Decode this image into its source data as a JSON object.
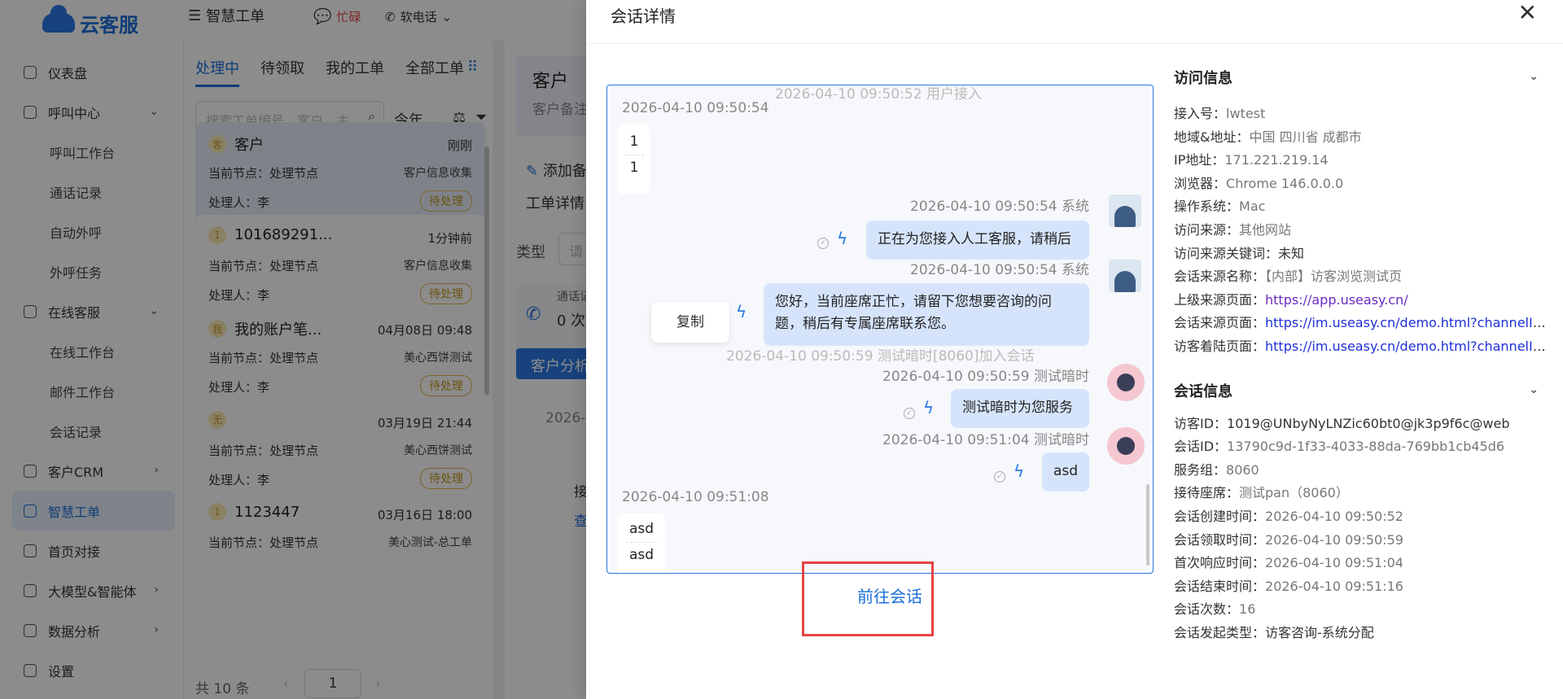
{
  "app": {
    "logo": "云客服"
  },
  "sidebar": {
    "items": [
      {
        "label": "仪表盘",
        "icon": "dashboard-icon",
        "type": "top"
      },
      {
        "label": "呼叫中心",
        "icon": "phone-icon",
        "type": "top",
        "arrow": "⌄"
      },
      {
        "label": "呼叫工作台",
        "type": "sub"
      },
      {
        "label": "通话记录",
        "type": "sub"
      },
      {
        "label": "自动外呼",
        "type": "sub"
      },
      {
        "label": "外呼任务",
        "type": "sub"
      },
      {
        "label": "在线客服",
        "icon": "headset-icon",
        "type": "top",
        "arrow": "⌄"
      },
      {
        "label": "在线工作台",
        "type": "sub"
      },
      {
        "label": "邮件工作台",
        "type": "sub"
      },
      {
        "label": "会话记录",
        "type": "sub"
      },
      {
        "label": "客户CRM",
        "icon": "user-icon",
        "type": "top",
        "arrow": "›"
      },
      {
        "label": "智慧工单",
        "icon": "ticket-icon",
        "type": "top",
        "active": true
      },
      {
        "label": "首页对接",
        "icon": "home-icon",
        "type": "top"
      },
      {
        "label": "大模型&智能体",
        "icon": "ai-icon",
        "type": "top",
        "arrow": "›"
      },
      {
        "label": "数据分析",
        "icon": "chart-icon",
        "type": "top",
        "arrow": "›"
      },
      {
        "label": "设置",
        "icon": "settings-icon",
        "type": "top"
      }
    ]
  },
  "topnav": {
    "title": "智慧工单",
    "busy": "忙碌",
    "softphone": "软电话",
    "status": "空闲"
  },
  "worklist": {
    "tabs": [
      "处理中",
      "待领取",
      "我的工单",
      "全部工单"
    ],
    "search_placeholder": "搜索工单编号、客户、主",
    "year": "今年",
    "cards": [
      {
        "badge": "客",
        "title": "客户",
        "time": "刚刚",
        "node": "当前节点：处理节点",
        "node_right": "客户信息收集",
        "handler": "处理人：李",
        "tag": "待处理"
      },
      {
        "badge": "1",
        "title": "101689291...",
        "time": "1分钟前",
        "node": "当前节点：处理节点",
        "node_right": "客户信息收集",
        "handler": "处理人：李",
        "tag": "待处理"
      },
      {
        "badge": "我",
        "title": "我的账户笔...",
        "time": "04月08日 09:48",
        "node": "当前节点：处理节点",
        "node_right": "美心西饼测试",
        "handler": "处理人：李",
        "tag": "待处理"
      },
      {
        "badge": "无",
        "title": "",
        "time": "03月19日 21:44",
        "node": "当前节点：处理节点",
        "node_right": "美心西饼测试",
        "handler": "处理人：李",
        "tag": "待处理"
      },
      {
        "badge": "1",
        "title": "1123447",
        "time": "03月16日 18:00",
        "node": "当前节点：处理节点",
        "node_right": "美心测试-总工单",
        "handler": "",
        "tag": ""
      }
    ],
    "total": "共 10 条",
    "page": "1"
  },
  "middle": {
    "title": "客户",
    "subtitle": "客户备注",
    "add": "添加备",
    "detail": "工单详情",
    "type_label": "类型",
    "type_placeholder": "请",
    "call_label": "通话记",
    "call_count": "0 次",
    "analyze_btn": "客户分析",
    "date": "2026-",
    "misc1": "接",
    "misc2": "查"
  },
  "drawer": {
    "title": "会话详情",
    "goto_label": "前往会话",
    "copy_label": "复制",
    "chat": {
      "sys_line_1": "2026-04-10 09:50:52 用户接入",
      "ts_1": "2026-04-10 09:50:54",
      "msg_in_1a": "1",
      "msg_in_1b": "1",
      "ts_2": "2026-04-10 09:50:54 系统",
      "msg_out_1": "正在为您接入人工客服，请稍后",
      "ts_3": "2026-04-10 09:50:54 系统",
      "msg_out_2": "您好，当前座席正忙，请留下您想要咨询的问题，稍后有专属座席联系您。",
      "sys_line_2": "2026-04-10 09:50:59 测试暗时[8060]加入会话",
      "ts_4": "2026-04-10 09:50:59 测试暗时",
      "msg_out_3": "测试暗时为您服务",
      "ts_5": "2026-04-10 09:51:04 测试暗时",
      "msg_out_4": "asd",
      "ts_6": "2026-04-10 09:51:08",
      "msg_in_2a": "asd",
      "msg_in_2b": "asd"
    },
    "visit": {
      "title": "访问信息",
      "rows": [
        {
          "k": "接入号：",
          "v": "lwtest",
          "style": "v"
        },
        {
          "k": "地域&地址：",
          "v": "中国 四川省 成都市",
          "style": "v"
        },
        {
          "k": "IP地址：",
          "v": "171.221.219.14",
          "style": "v"
        },
        {
          "k": "浏览器：",
          "v": "Chrome 146.0.0.0",
          "style": "v"
        },
        {
          "k": "操作系统：",
          "v": "Mac",
          "style": "v"
        },
        {
          "k": "访问来源：",
          "v": "其他网站",
          "style": "v"
        },
        {
          "k": "访问来源关键词：",
          "v": "未知",
          "style": "k"
        },
        {
          "k": "会话来源名称：",
          "v": "【内部】访客浏览测试页",
          "style": "v"
        },
        {
          "k": "上级来源页面：",
          "v": "https://app.useasy.cn/",
          "style": "lk2"
        },
        {
          "k": "会话来源页面：",
          "v": "https://im.useasy.cn/demo.html?channelId...",
          "style": "lk"
        },
        {
          "k": "访客着陆页面：",
          "v": "https://im.useasy.cn/demo.html?channelId...",
          "style": "lk"
        }
      ]
    },
    "session": {
      "title": "会话信息",
      "rows": [
        {
          "k": "访客ID：",
          "v": "1019@UNbyNyLNZic60bt0@jk3p9f6c@web",
          "style": "k"
        },
        {
          "k": "会话ID：",
          "v": "13790c9d-1f33-4033-88da-769bb1cb45d6",
          "style": "v"
        },
        {
          "k": "服务组：",
          "v": "8060",
          "style": "v"
        },
        {
          "k": "接待座席：",
          "v": "测试pan（8060）",
          "style": "v"
        },
        {
          "k": "会话创建时间：",
          "v": "2026-04-10 09:50:52",
          "style": "v"
        },
        {
          "k": "会话领取时间：",
          "v": "2026-04-10 09:50:59",
          "style": "v"
        },
        {
          "k": "首次响应时间：",
          "v": "2026-04-10 09:51:04",
          "style": "v"
        },
        {
          "k": "会话结束时间：",
          "v": "2026-04-10 09:51:16",
          "style": "v"
        },
        {
          "k": "会话次数：",
          "v": "16",
          "style": "v"
        },
        {
          "k": "会话发起类型：",
          "v": "访客咨询-系统分配",
          "style": "k"
        }
      ]
    }
  }
}
